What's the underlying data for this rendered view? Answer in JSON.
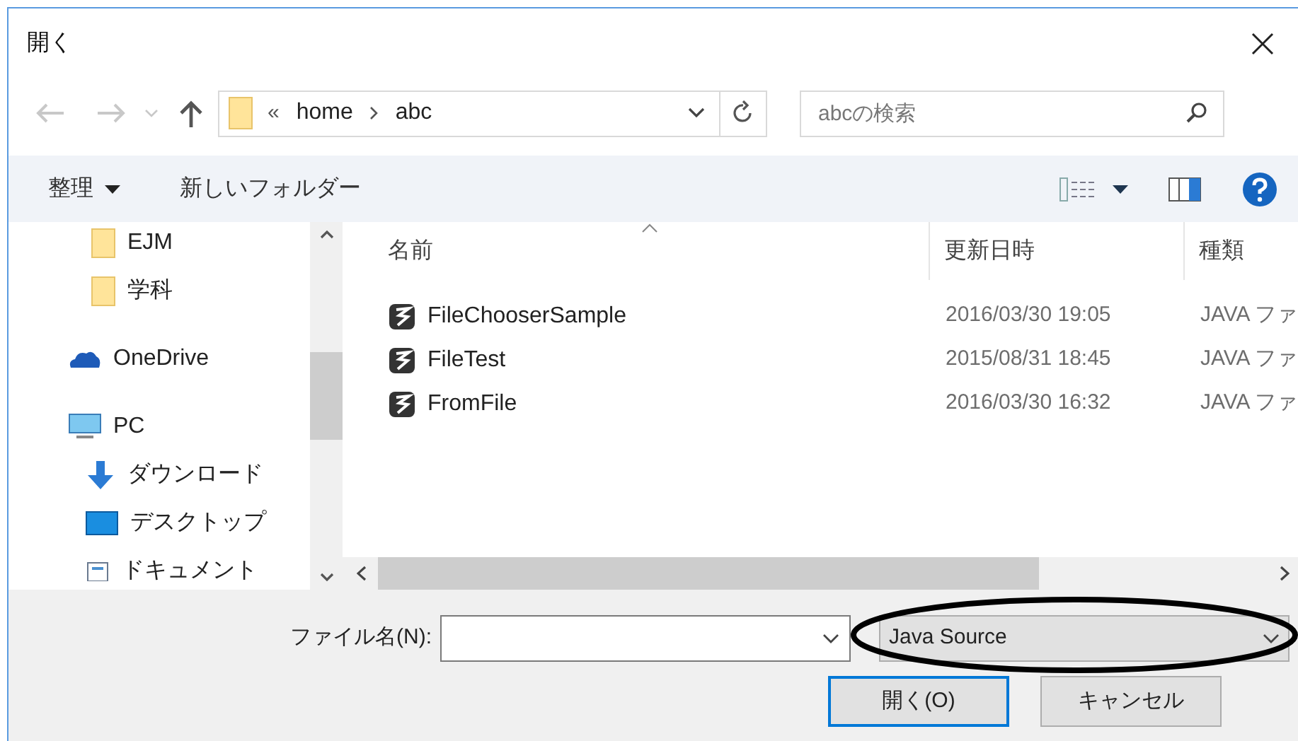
{
  "window": {
    "title": "開く"
  },
  "address_bar": {
    "overflow": "«",
    "segments": [
      "home",
      "abc"
    ]
  },
  "search": {
    "placeholder": "abcの検索"
  },
  "toolbar": {
    "organize": "整理",
    "new_folder": "新しいフォルダー"
  },
  "sidebar": {
    "items": [
      {
        "label": "EJM",
        "kind": "folder"
      },
      {
        "label": "学科",
        "kind": "folder"
      },
      {
        "label": "OneDrive",
        "kind": "cloud"
      },
      {
        "label": "PC",
        "kind": "pc",
        "children": [
          {
            "label": "ダウンロード",
            "kind": "download"
          },
          {
            "label": "デスクトップ",
            "kind": "desktop"
          },
          {
            "label": "ドキュメント",
            "kind": "documents"
          }
        ]
      }
    ]
  },
  "table": {
    "columns": [
      "名前",
      "更新日時",
      "種類"
    ],
    "rows": [
      {
        "name": "FileChooserSample",
        "modified": "2016/03/30 19:05",
        "type": "JAVA ファ"
      },
      {
        "name": "FileTest",
        "modified": "2015/08/31 18:45",
        "type": "JAVA ファ"
      },
      {
        "name": "FromFile",
        "modified": "2016/03/30 16:32",
        "type": "JAVA ファ"
      }
    ]
  },
  "footer": {
    "filename_label": "ファイル名(N):",
    "filter": "Java Source",
    "buttons": [
      {
        "label": "開く(O)",
        "default": true
      },
      {
        "label": "キャンセル",
        "default": false
      }
    ]
  }
}
